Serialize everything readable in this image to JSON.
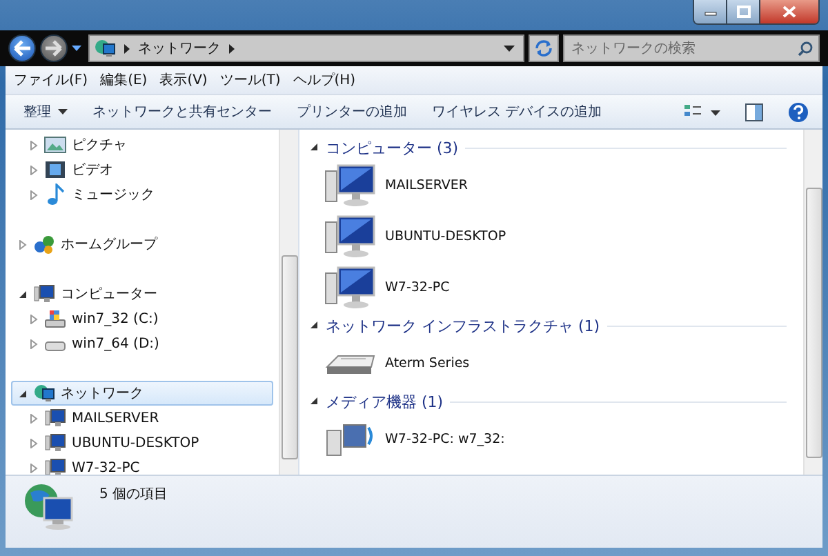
{
  "address_bar": {
    "segments": [
      "ネットワーク"
    ]
  },
  "search": {
    "placeholder": "ネットワークの検索"
  },
  "menu": [
    "ファイル(F)",
    "編集(E)",
    "表示(V)",
    "ツール(T)",
    "ヘルプ(H)"
  ],
  "toolbar": [
    {
      "label": "整理",
      "dropdown": true
    },
    {
      "label": "ネットワークと共有センター",
      "dropdown": false
    },
    {
      "label": "プリンターの追加",
      "dropdown": false
    },
    {
      "label": "ワイヤレス デバイスの追加",
      "dropdown": false
    }
  ],
  "nav_sections": [
    {
      "items": [
        {
          "label": "ピクチャ",
          "kind": "pictures",
          "expanded": false,
          "selected": false
        },
        {
          "label": "ビデオ",
          "kind": "video",
          "expanded": false,
          "selected": false
        },
        {
          "label": "ミュージック",
          "kind": "music",
          "expanded": false,
          "selected": false
        }
      ]
    },
    {
      "items": [
        {
          "label": "ホームグループ",
          "kind": "homegroup",
          "expanded": false,
          "selected": false
        }
      ]
    },
    {
      "items": [
        {
          "label": "コンピューター",
          "kind": "computer",
          "expanded": true,
          "selected": false,
          "children": [
            {
              "label": "win7_32 (C:)",
              "kind": "system-drive",
              "expanded": false,
              "selected": false
            },
            {
              "label": "win7_64 (D:)",
              "kind": "drive",
              "expanded": false,
              "selected": false
            }
          ]
        }
      ]
    },
    {
      "items": [
        {
          "label": "ネットワーク",
          "kind": "network",
          "expanded": true,
          "selected": true,
          "children": [
            {
              "label": "MAILSERVER",
              "kind": "pc",
              "expanded": false,
              "selected": false
            },
            {
              "label": "UBUNTU-DESKTOP",
              "kind": "pc",
              "expanded": false,
              "selected": false
            },
            {
              "label": "W7-32-PC",
              "kind": "pc",
              "expanded": false,
              "selected": false
            }
          ]
        }
      ]
    }
  ],
  "groups": [
    {
      "title": "コンピューター (3)",
      "expanded": true,
      "items": [
        {
          "label": "MAILSERVER",
          "kind": "computer"
        },
        {
          "label": "UBUNTU-DESKTOP",
          "kind": "computer"
        },
        {
          "label": "W7-32-PC",
          "kind": "computer"
        }
      ]
    },
    {
      "title": "ネットワーク インフラストラクチャ (1)",
      "expanded": true,
      "items": [
        {
          "label": "Aterm Series",
          "kind": "router"
        }
      ]
    },
    {
      "title": "メディア機器 (1)",
      "expanded": true,
      "items": [
        {
          "label": "W7-32-PC: w7_32:",
          "kind": "media"
        }
      ]
    }
  ],
  "status_bar": {
    "text": "5 個の項目"
  }
}
